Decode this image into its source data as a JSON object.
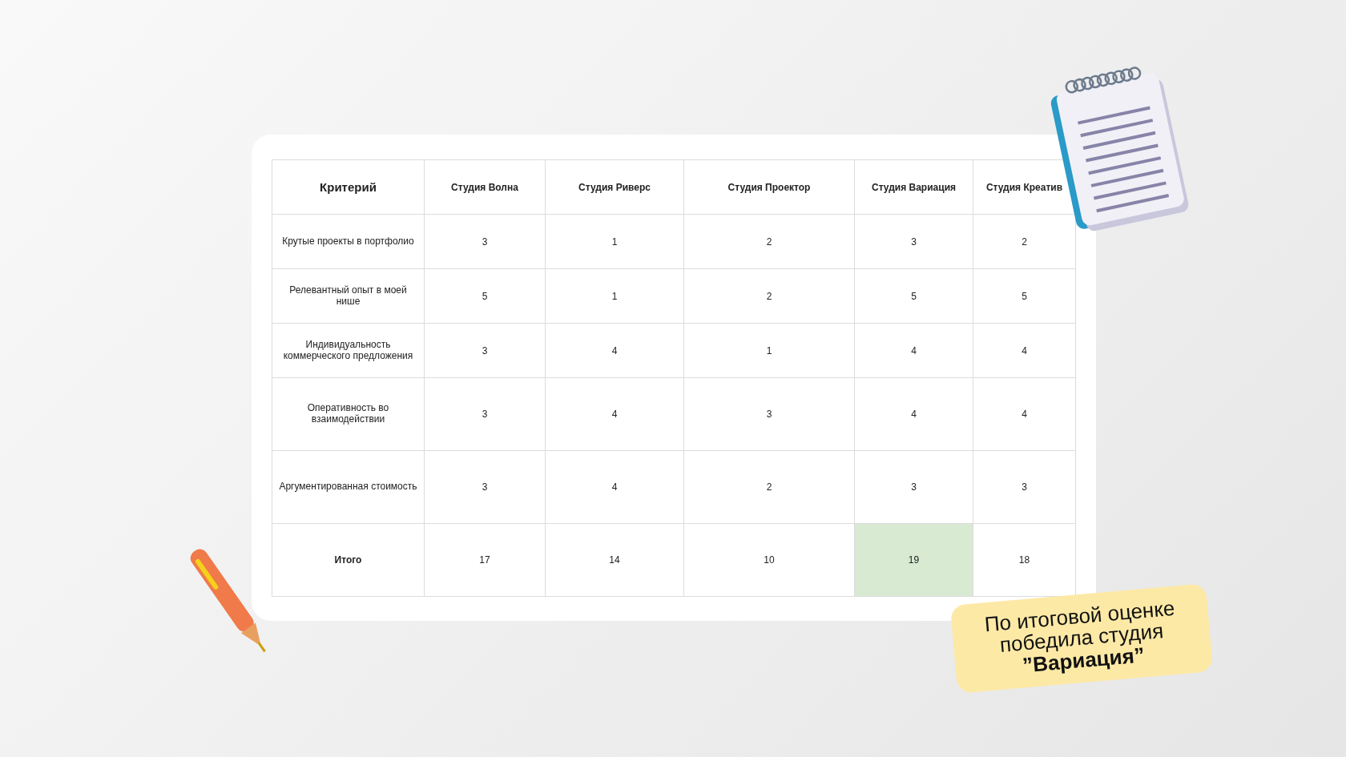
{
  "table": {
    "columns": [
      "Критерий",
      "Студия Волна",
      "Студия Риверс",
      "Студия Проектор",
      "Студия Вариация",
      "Студия Креатив"
    ],
    "rows": [
      {
        "criterion": "Крутые проекты в портфолио",
        "values": [
          "3",
          "1",
          "2",
          "3",
          "2"
        ]
      },
      {
        "criterion": "Релевантный опыт в моей нише",
        "values": [
          "5",
          "1",
          "2",
          "5",
          "5"
        ]
      },
      {
        "criterion": "Индивидуальность коммерческого предложения",
        "values": [
          "3",
          "4",
          "1",
          "4",
          "4"
        ]
      },
      {
        "criterion": "Оперативность во взаимодействии",
        "values": [
          "3",
          "4",
          "3",
          "4",
          "4"
        ]
      },
      {
        "criterion": "Аргументированная стоимость",
        "values": [
          "3",
          "4",
          "2",
          "3",
          "3"
        ]
      }
    ],
    "total": {
      "label": "Итого",
      "cells": [
        {
          "value": "17",
          "highlighted": false
        },
        {
          "value": "14",
          "highlighted": false
        },
        {
          "value": "10",
          "highlighted": false
        },
        {
          "value": "19",
          "highlighted": true
        },
        {
          "value": "18",
          "highlighted": false
        }
      ]
    }
  },
  "sticker": {
    "text": "По итоговой оценке победила студия **”Вариация”**"
  }
}
